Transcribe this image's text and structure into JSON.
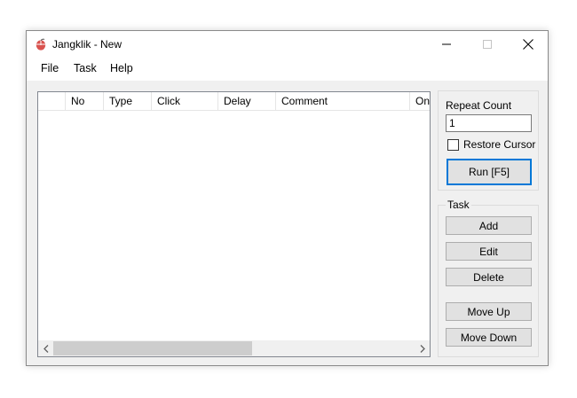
{
  "window": {
    "title": "Jangklik - New",
    "icon": "mouse-icon",
    "controls": {
      "minimize": "minimize-icon",
      "maximize": "maximize-icon",
      "close": "close-icon"
    }
  },
  "menu": [
    {
      "label": "File"
    },
    {
      "label": "Task"
    },
    {
      "label": "Help"
    }
  ],
  "list": {
    "columns": [
      "",
      "No",
      "Type",
      "Click",
      "Delay",
      "Comment",
      "On"
    ],
    "rows": []
  },
  "scrollbar": {
    "left_arrow": "<",
    "right_arrow": ">"
  },
  "repeat": {
    "label": "Repeat Count",
    "value": "1",
    "restore_cursor_label": "Restore Cursor",
    "restore_cursor_checked": false,
    "run_label": "Run [F5]"
  },
  "task": {
    "group_label": "Task",
    "buttons": [
      "Add",
      "Edit",
      "Delete",
      "Move Up",
      "Move Down"
    ]
  },
  "colors": {
    "focus_border": "#0078d7",
    "window_bg": "#f0f0f0",
    "icon_red": "#d9534f"
  }
}
